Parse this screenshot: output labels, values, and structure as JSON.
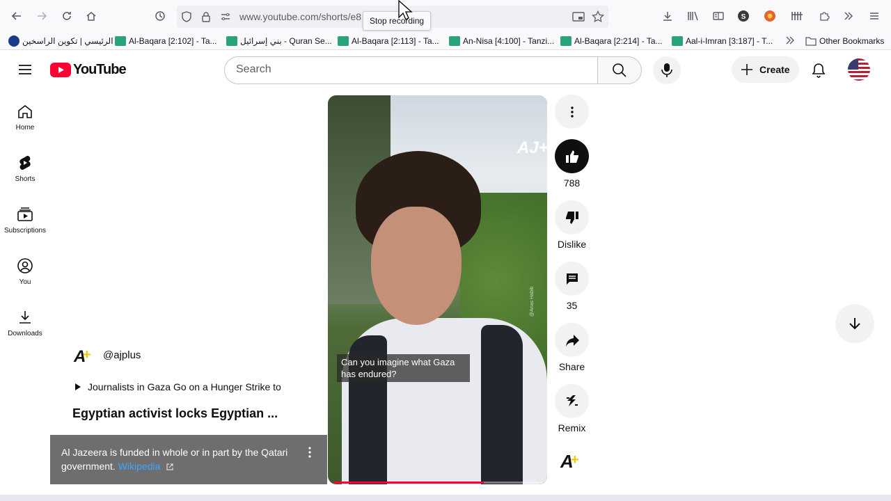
{
  "browser": {
    "url": "www.youtube.com/shorts/e8",
    "tooltip": "Stop recording",
    "bookmarks": [
      {
        "label": "الرئيسي | تكوين الراسخين"
      },
      {
        "label": "Al-Baqara [2:102] - Ta..."
      },
      {
        "label": "بني إسرائيل - Quran Se..."
      },
      {
        "label": "Al-Baqara [2:113] - Ta..."
      },
      {
        "label": "An-Nisa [4:100] - Tanzi..."
      },
      {
        "label": "Al-Baqara [2:214] - Ta..."
      },
      {
        "label": "Aal-i-Imran [3:187] - T..."
      }
    ],
    "other_bookmarks": "Other Bookmarks"
  },
  "header": {
    "logo_text": "YouTube",
    "search_placeholder": "Search",
    "create_label": "Create"
  },
  "guide": {
    "items": [
      {
        "label": "Home",
        "icon": "home-icon"
      },
      {
        "label": "Shorts",
        "icon": "shorts-icon"
      },
      {
        "label": "Subscriptions",
        "icon": "subscriptions-icon"
      },
      {
        "label": "You",
        "icon": "you-icon"
      },
      {
        "label": "Downloads",
        "icon": "downloads-icon"
      }
    ]
  },
  "video": {
    "caption_line1": "Can you imagine what Gaza",
    "caption_line2": "has endured?",
    "watermark": "@Anas Habib",
    "progress_fraction": 0.72,
    "logo": "AJ+"
  },
  "actions": {
    "likes": "788",
    "dislike_label": "Dislike",
    "comments": "35",
    "share_label": "Share",
    "remix_label": "Remix"
  },
  "channel": {
    "handle": "@ajplus",
    "playlist": "Journalists in Gaza Go on a Hunger Strike to",
    "title": "Egyptian activist locks Egyptian ...",
    "info_text": "Al Jazeera is funded in whole or in part by the Qatari government.",
    "info_link": "Wikipedia"
  },
  "colors": {
    "accent_red": "#ff0033",
    "like_active": "#0f0f0f",
    "link_blue": "#3ea6ff"
  }
}
